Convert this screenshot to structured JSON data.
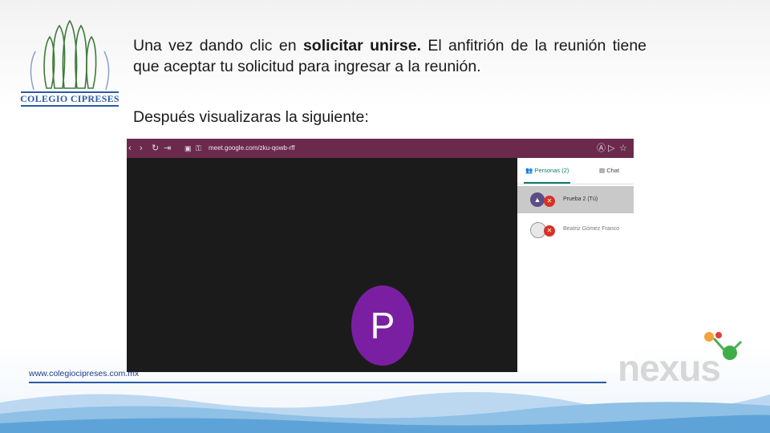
{
  "logo": {
    "text": "COLEGIO CIPRESES"
  },
  "slide": {
    "paragraph_part1": "Una vez dando clic en ",
    "paragraph_bold": "solicitar unirse.",
    "paragraph_part2": "  El anfitrión de la reunión tiene que aceptar tu solicitud para ingresar a la reunión.",
    "line2": "Después visualizaras la siguiente:"
  },
  "meet": {
    "url": "meet.google.com/zku-qowb-rff",
    "tabs": {
      "people": "Personas (2)",
      "chat": "Chat"
    },
    "participants": [
      {
        "name": "Prueba 2 (Tú)"
      },
      {
        "name": "Beatriz Gómez Franco"
      }
    ],
    "avatar_letter": "P",
    "colors": {
      "browser_bar": "#6b2a4c",
      "avatar": "#7b1fa2",
      "accent": "#137a6d"
    }
  },
  "footer": {
    "url": "www.colegiocipreses.com.mx",
    "brand": "nexus"
  }
}
